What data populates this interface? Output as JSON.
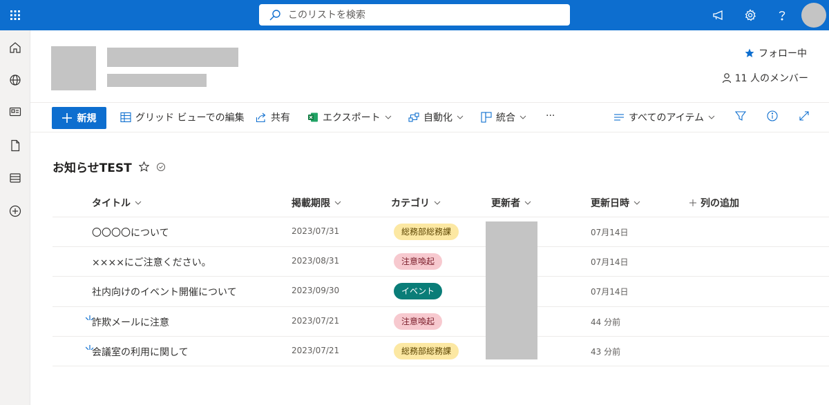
{
  "topbar": {
    "search_placeholder": "このリストを検索"
  },
  "site": {
    "follow_label": "フォロー中",
    "members_label": "11 人のメンバー"
  },
  "commandbar": {
    "new_label": "新規",
    "grid_edit_label": "グリッド ビューでの編集",
    "share_label": "共有",
    "export_label": "エクスポート",
    "automate_label": "自動化",
    "integrate_label": "統合",
    "more_label": "···",
    "view_label": "すべてのアイテム"
  },
  "list": {
    "title": "お知らせTEST",
    "columns": {
      "title": "タイトル",
      "deadline": "掲載期限",
      "category": "カテゴリ",
      "author": "更新者",
      "modified": "更新日時",
      "add_column": "列の追加"
    },
    "rows": [
      {
        "title": "〇〇〇〇について",
        "deadline": "2023/07/31",
        "category": "総務部総務課",
        "modified": "07月14日",
        "is_new": false
      },
      {
        "title": "××××にご注意ください。",
        "deadline": "2023/08/31",
        "category": "注意喚起",
        "modified": "07月14日",
        "is_new": false
      },
      {
        "title": "社内向けのイベント開催について",
        "deadline": "2023/09/30",
        "category": "イベント",
        "modified": "07月14日",
        "is_new": false
      },
      {
        "title": "詐欺メールに注意",
        "deadline": "2023/07/21",
        "category": "注意喚起",
        "modified": "44 分前",
        "is_new": true
      },
      {
        "title": "会議室の利用に関して",
        "deadline": "2023/07/21",
        "category": "総務部総務課",
        "modified": "43 分前",
        "is_new": true
      }
    ]
  },
  "colors": {
    "brand": "#0d6ecf",
    "badge_general_bg": "#fce8a3",
    "badge_alert_bg": "#f7c9cf",
    "badge_event_bg": "#0a7d78"
  }
}
